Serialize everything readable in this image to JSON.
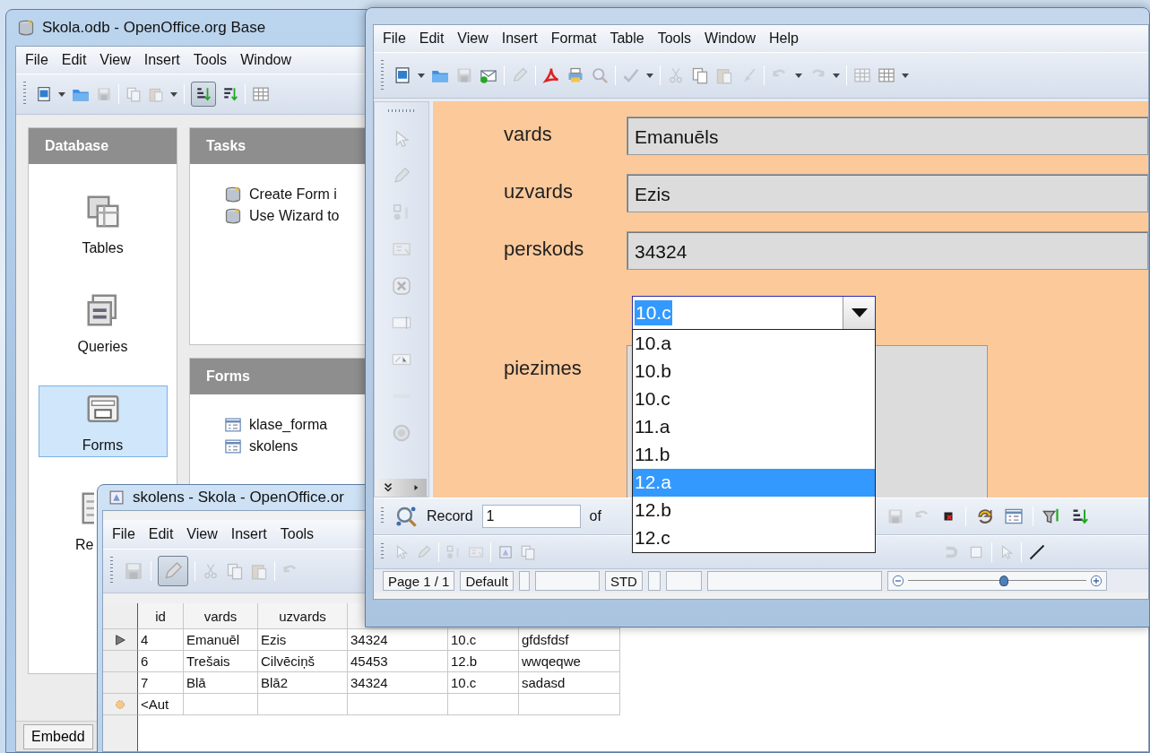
{
  "base_window": {
    "title": "Skola.odb - OpenOffice.org Base",
    "menu": [
      "File",
      "Edit",
      "View",
      "Insert",
      "Tools",
      "Window"
    ],
    "sort_ascending_on": true,
    "database_panel": {
      "title": "Database",
      "items": [
        {
          "label": "Tables",
          "kind": "tables",
          "selected": false
        },
        {
          "label": "Queries",
          "kind": "queries",
          "selected": false
        },
        {
          "label": "Forms",
          "kind": "forms",
          "selected": true
        },
        {
          "label": "Re",
          "kind": "reports",
          "selected": false
        }
      ]
    },
    "tasks_panel": {
      "title": "Tasks",
      "items": [
        "Create Form i",
        "Use Wizard to"
      ]
    },
    "forms_panel": {
      "title": "Forms",
      "items": [
        "klase_forma",
        "skolens"
      ]
    },
    "status_bar": "Embedd"
  },
  "table_window": {
    "title": "skolens - Skola - OpenOffice.or",
    "menu": [
      "File",
      "Edit",
      "View",
      "Insert",
      "Tools"
    ],
    "edit_mode_on": true,
    "columns": [
      "id",
      "vards",
      "uzvards"
    ],
    "rows": [
      {
        "current": true,
        "cells": [
          "4",
          "Emanuēl",
          "Ezis",
          "34324",
          "10.c",
          "gfdsfdsf"
        ]
      },
      {
        "current": false,
        "cells": [
          "6",
          "Trešais",
          "Cilvēciņš",
          "45453",
          "12.b",
          "wwqeqwe"
        ]
      },
      {
        "current": false,
        "cells": [
          "7",
          "Blā",
          "Blā2",
          "34324",
          "10.c",
          "sadasd"
        ]
      }
    ],
    "new_row": "<Aut"
  },
  "form_window": {
    "menu": [
      "File",
      "Edit",
      "View",
      "Insert",
      "Format",
      "Table",
      "Tools",
      "Window",
      "Help"
    ],
    "fields": [
      {
        "label": "vards",
        "value": "Emanuēls"
      },
      {
        "label": "uzvards",
        "value": "Ezis"
      },
      {
        "label": "perskods",
        "value": "34324"
      }
    ],
    "class_combo": {
      "value": "10.c",
      "options": [
        {
          "label": "10.a",
          "highlighted": false
        },
        {
          "label": "10.b",
          "highlighted": false
        },
        {
          "label": "10.c",
          "highlighted": false
        },
        {
          "label": "11.a",
          "highlighted": false
        },
        {
          "label": "11.b",
          "highlighted": false
        },
        {
          "label": "12.a",
          "highlighted": true
        },
        {
          "label": "12.b",
          "highlighted": false
        },
        {
          "label": "12.c",
          "highlighted": false
        }
      ]
    },
    "notes_label": "piezimes",
    "record_bar": {
      "label": "Record",
      "value": "1",
      "of": "of"
    },
    "status_bar": {
      "page": "Page 1 / 1",
      "style": "Default",
      "mode": "STD",
      "zoom": {
        "level": 0.54
      }
    }
  }
}
